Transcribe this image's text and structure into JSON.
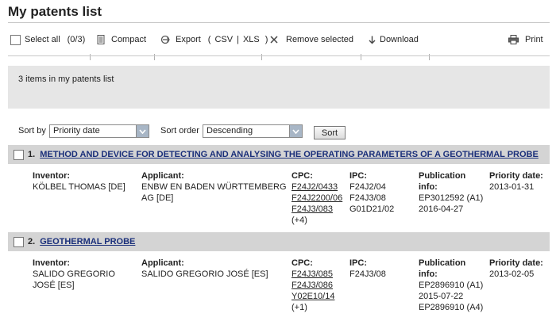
{
  "page": {
    "title": "My patents list"
  },
  "toolbar": {
    "select_all": "Select all",
    "select_count": "(0/3)",
    "compact": "Compact",
    "export": "Export",
    "export_paren_open": "(",
    "export_csv": "CSV",
    "export_sep": "|",
    "export_xls": "XLS",
    "export_paren_close": ")",
    "remove_selected": "Remove selected",
    "download": "Download",
    "print": "Print"
  },
  "info": {
    "text": "3 items in my patents list"
  },
  "sort": {
    "sort_by_label": "Sort by",
    "sort_by_value": "Priority date",
    "sort_order_label": "Sort order",
    "sort_order_value": "Descending",
    "button": "Sort"
  },
  "labels": {
    "inventor": "Inventor:",
    "applicant": "Applicant:",
    "cpc": "CPC:",
    "ipc": "IPC:",
    "publication_1": "Publication",
    "publication_2": "info:",
    "priority": "Priority date:"
  },
  "results": [
    {
      "num": "1.",
      "title": "METHOD AND DEVICE FOR DETECTING AND ANALYSING THE OPERATING PARAMETERS OF A GEOTHERMAL PROBE",
      "inventor": [
        "KÖLBEL THOMAS  [DE]"
      ],
      "applicant": [
        "ENBW EN BADEN WÜRTTEMBERG",
        "AG  [DE]"
      ],
      "cpc": [
        "F24J2/0433",
        "F24J2200/06",
        "F24J3/083"
      ],
      "cpc_more": "(+4)",
      "ipc": [
        "F24J2/04",
        "F24J3/08",
        "G01D21/02"
      ],
      "publication": [
        "EP3012592 (A1)",
        "2016-04-27"
      ],
      "priority_date": "2013-01-31"
    },
    {
      "num": "2.",
      "title": "GEOTHERMAL PROBE",
      "inventor": [
        "SALIDO GREGORIO",
        "JOSÉ  [ES]"
      ],
      "applicant": [
        "SALIDO GREGORIO JOSÉ  [ES]"
      ],
      "cpc": [
        "F24J3/085",
        "F24J3/086",
        "Y02E10/14"
      ],
      "cpc_more": "(+1)",
      "ipc": [
        "F24J3/08"
      ],
      "publication": [
        "EP2896910 (A1)",
        "2015-07-22",
        "EP2896910 (A4)"
      ],
      "priority_date": "2013-02-05"
    }
  ]
}
